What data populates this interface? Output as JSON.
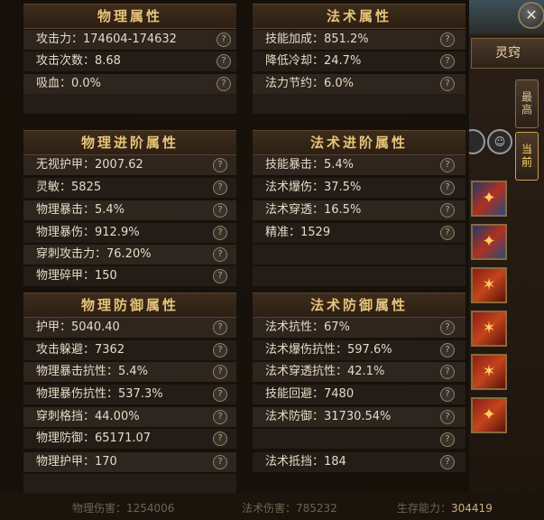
{
  "panel": {
    "sections": {
      "physical": {
        "title": "物理属性",
        "rows": [
          {
            "label": "攻击力：174604-174632"
          },
          {
            "label": "攻击次数：8.68"
          },
          {
            "label": "吸血：0.0%"
          }
        ]
      },
      "magic": {
        "title": "法术属性",
        "rows": [
          {
            "label": "技能加成：851.2%"
          },
          {
            "label": "降低冷却：24.7%"
          },
          {
            "label": "法力节约：6.0%"
          }
        ]
      },
      "physical_adv": {
        "title": "物理进阶属性",
        "rows": [
          {
            "label": "无视护甲：2007.62"
          },
          {
            "label": "灵敏：5825"
          },
          {
            "label": "物理暴击：5.4%"
          },
          {
            "label": "物理暴伤：912.9%"
          },
          {
            "label": "穿刺攻击力：76.20%"
          },
          {
            "label": "物理碎甲：150"
          }
        ]
      },
      "magic_adv": {
        "title": "法术进阶属性",
        "rows": [
          {
            "label": "技能暴击：5.4%"
          },
          {
            "label": "法术爆伤：37.5%"
          },
          {
            "label": "法术穿透：16.5%"
          },
          {
            "label": "精准：1529"
          }
        ]
      },
      "physical_def": {
        "title": "物理防御属性",
        "rows": [
          {
            "label": "护甲：5040.40"
          },
          {
            "label": "攻击躲避：7362"
          },
          {
            "label": "物理暴击抗性：5.4%"
          },
          {
            "label": "物理暴伤抗性：537.3%"
          },
          {
            "label": "穿刺格挡：44.00%"
          },
          {
            "label": "物理防御：65171.07"
          },
          {
            "label": "物理护甲：170"
          }
        ]
      },
      "magic_def": {
        "title": "法术防御属性",
        "rows": [
          {
            "label": "法术抗性：67%"
          },
          {
            "label": "法术爆伤抗性：597.6%"
          },
          {
            "label": "法术穿透抗性：42.1%"
          },
          {
            "label": "技能回避：7480"
          },
          {
            "label": "法术防御：31730.54%"
          },
          {
            "label": "法术抵挡：184"
          }
        ]
      }
    },
    "help_glyph": "?"
  },
  "footer": {
    "stat1": "物理伤害：1254006",
    "stat2": "法术伤害：785232",
    "stat3_label": "生存能力：",
    "stat3_value": "304419"
  },
  "sidebar": {
    "tab_label": "灵窍",
    "btn_top": "最高",
    "btn_current": "当前",
    "close_glyph": "✕"
  },
  "colors": {
    "title_gold": "#e7c47a",
    "row_text": "#e4dac6",
    "panel_bg": "#16100a"
  },
  "icons": [
    "close-icon",
    "help-icon",
    "skill-icon"
  ]
}
